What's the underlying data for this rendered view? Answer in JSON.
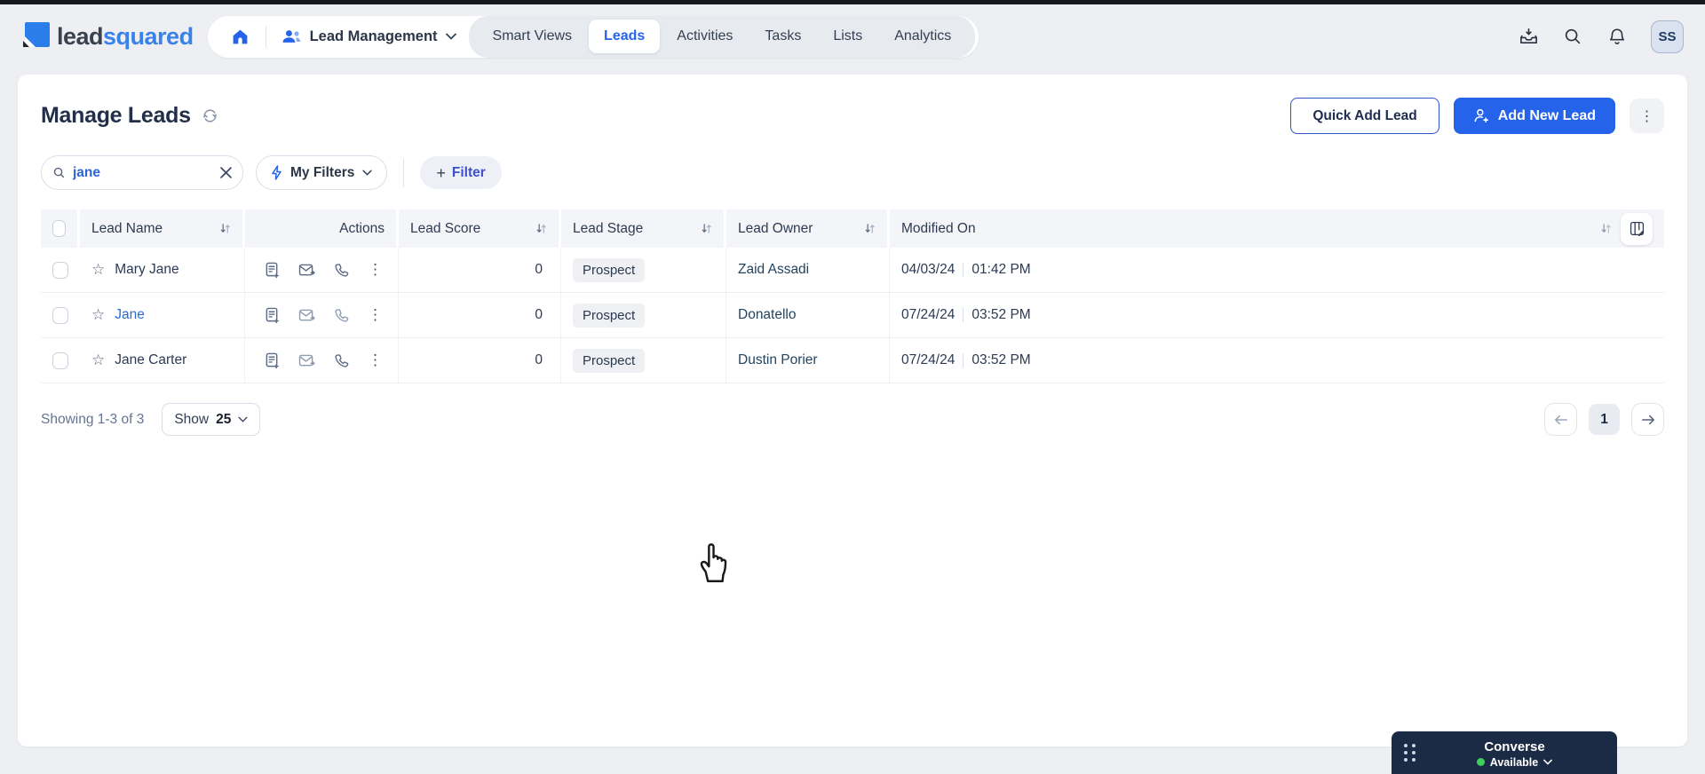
{
  "colors": {
    "accent": "#2563eb",
    "link": "#2a6bd6",
    "converse_bg": "#1c2b45",
    "available_green": "#3ecf5a",
    "logo_blue": "#3b82e8"
  },
  "brand": {
    "lead": "lead",
    "squared": "squared"
  },
  "nav": {
    "app_menu_label": "Lead Management",
    "tabs": [
      {
        "label": "Smart Views",
        "active": false
      },
      {
        "label": "Leads",
        "active": true
      },
      {
        "label": "Activities",
        "active": false
      },
      {
        "label": "Tasks",
        "active": false
      },
      {
        "label": "Lists",
        "active": false
      },
      {
        "label": "Analytics",
        "active": false
      }
    ],
    "avatar_initials": "SS"
  },
  "page": {
    "title": "Manage Leads",
    "quick_add_label": "Quick Add Lead",
    "add_new_label": "Add New Lead"
  },
  "filters": {
    "search_value": "jane",
    "my_filters_label": "My Filters",
    "plus": "+",
    "filter_label": "Filter"
  },
  "table": {
    "columns": {
      "name": "Lead Name",
      "actions": "Actions",
      "score": "Lead Score",
      "stage": "Lead Stage",
      "owner": "Lead Owner",
      "modified": "Modified On"
    },
    "rows": [
      {
        "name": "Mary Jane",
        "score": "0",
        "stage": "Prospect",
        "owner": "Zaid Assadi",
        "date": "04/03/24",
        "time": "01:42 PM"
      },
      {
        "name": "Jane",
        "score": "0",
        "stage": "Prospect",
        "owner": "Donatello",
        "date": "07/24/24",
        "time": "03:52 PM"
      },
      {
        "name": "Jane Carter",
        "score": "0",
        "stage": "Prospect",
        "owner": "Dustin Porier",
        "date": "07/24/24",
        "time": "03:52 PM"
      }
    ]
  },
  "footer": {
    "showing": "Showing 1-3 of 3",
    "show_word": "Show",
    "show_count": "25",
    "page": "1",
    "ellipsis": "⋮"
  },
  "converse": {
    "title": "Converse",
    "status": "Available"
  },
  "glyphs": {
    "star": "☆",
    "dots": "⋮"
  }
}
